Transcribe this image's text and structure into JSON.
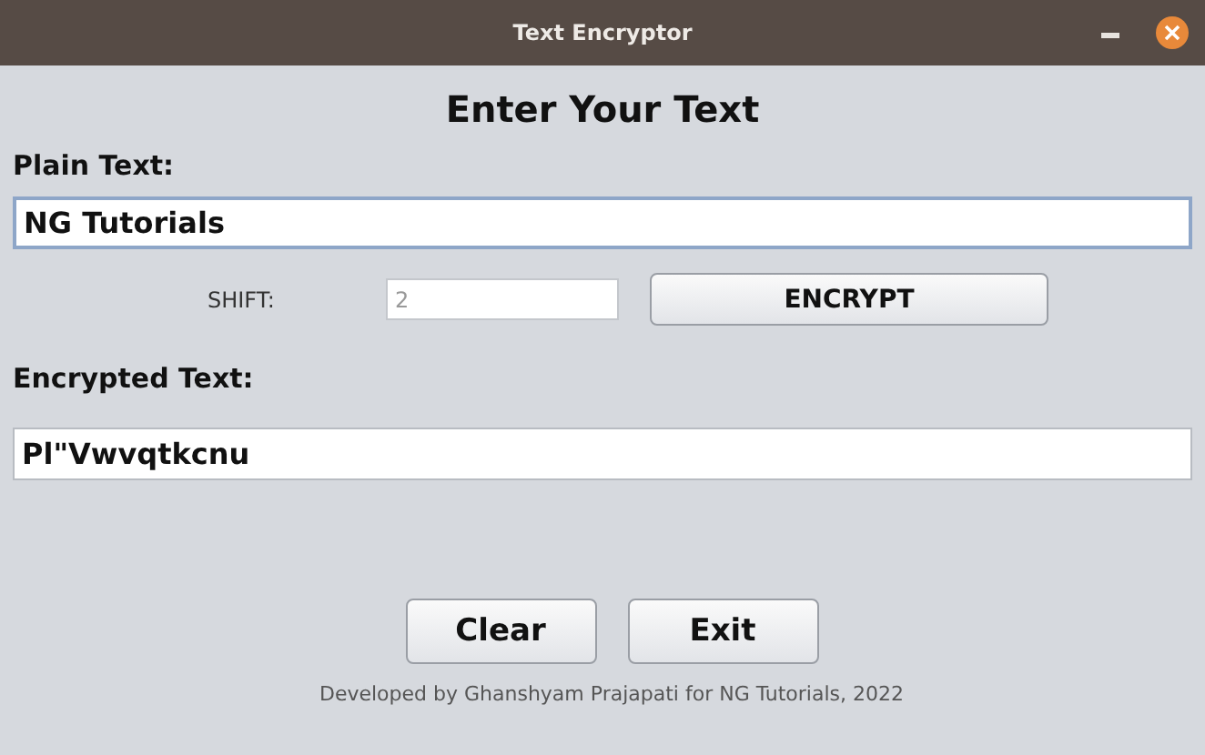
{
  "window": {
    "title": "Text Encryptor"
  },
  "heading": "Enter Your Text",
  "plain_text": {
    "label": "Plain Text:",
    "value": "NG Tutorials",
    "focused": true
  },
  "shift": {
    "label": "SHIFT:",
    "value": "2"
  },
  "encrypt_button": "ENCRYPT",
  "encrypted_text": {
    "label": "Encrypted Text:",
    "value": "Pl\"Vwvqtkcnu",
    "focused": false
  },
  "buttons": [
    "Clear",
    "Exit"
  ],
  "footer": "Developed by Ghanshyam Prajapati for NG Tutorials, 2022"
}
